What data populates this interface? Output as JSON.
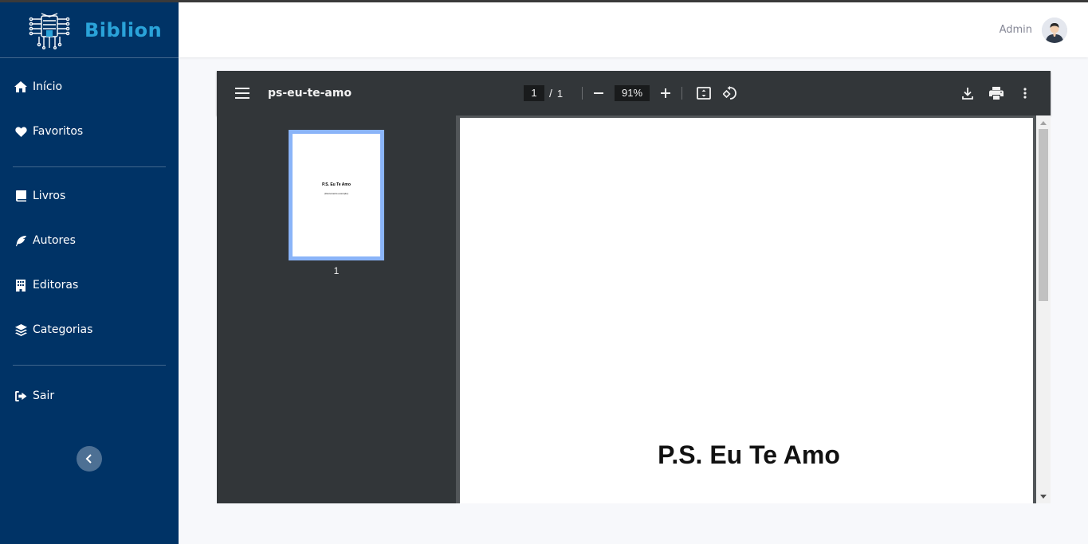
{
  "app": {
    "brand_name": "Biblion",
    "brand_color": "#2aa3d9",
    "sidebar_color": "#003366"
  },
  "sidebar": {
    "items": [
      {
        "label": "Início",
        "icon": "home-icon"
      },
      {
        "label": "Favoritos",
        "icon": "heart-icon"
      },
      {
        "label": "Livros",
        "icon": "book-icon"
      },
      {
        "label": "Autores",
        "icon": "feather-icon"
      },
      {
        "label": "Editoras",
        "icon": "building-icon"
      },
      {
        "label": "Categorias",
        "icon": "layers-icon"
      },
      {
        "label": "Sair",
        "icon": "sign-out-icon"
      }
    ],
    "collapse_icon": "chevron-left-icon"
  },
  "header": {
    "user_name": "Admin",
    "avatar_icon": "user-avatar"
  },
  "pdf_viewer": {
    "document_title": "ps-eu-te-amo",
    "current_page": "1",
    "page_separator": "/",
    "total_pages": "1",
    "zoom": "91%",
    "thumbnail": {
      "title": "P.S. Eu Te Amo",
      "subtitle": "(Documento exemplo)",
      "page_number": "1"
    },
    "page_content": {
      "title": "P.S. Eu Te Amo"
    },
    "toolbar_icons": [
      "menu-icon",
      "zoom-out-icon",
      "zoom-in-icon",
      "fit-page-icon",
      "rotate-icon",
      "download-icon",
      "print-icon",
      "more-vert-icon"
    ],
    "thumbnail_highlight_color": "#8ab4f8",
    "toolbar_color": "#323639"
  }
}
